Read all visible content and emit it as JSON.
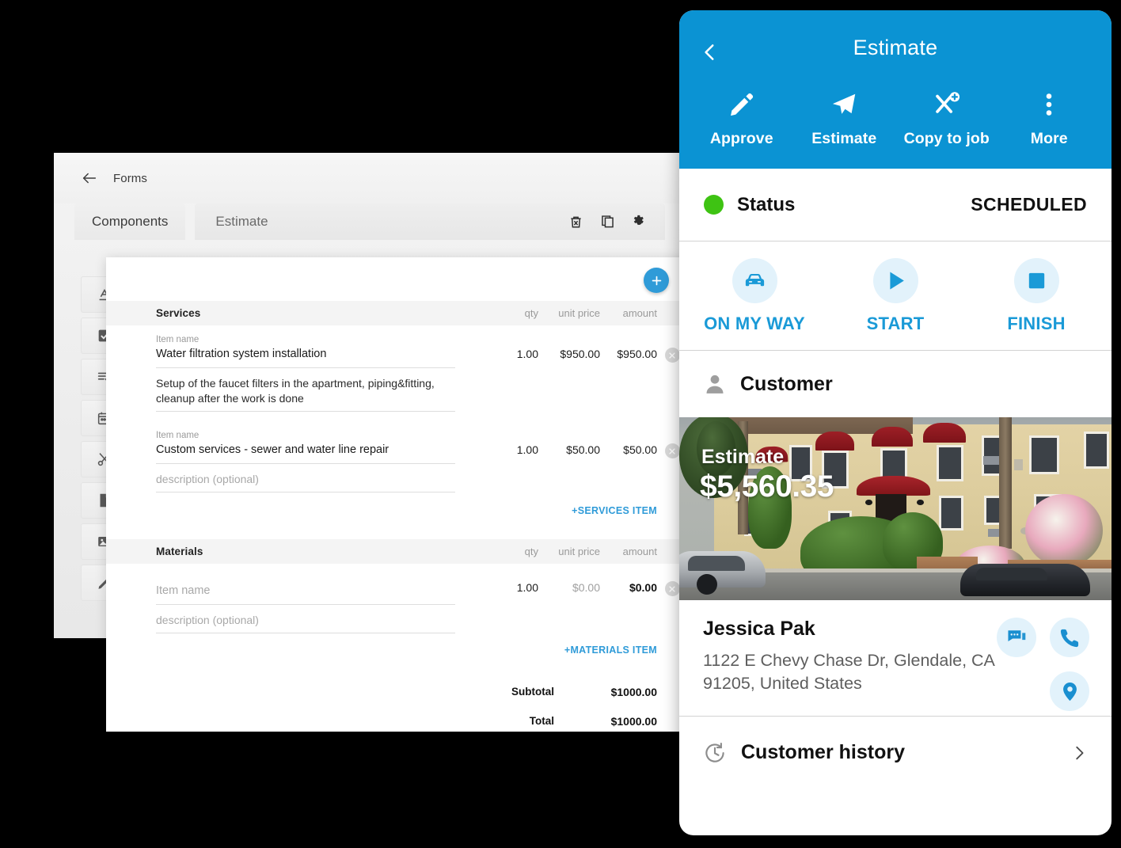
{
  "desktop": {
    "back_label": "Forms",
    "tabs": {
      "components": "Components",
      "estimate": "Estimate"
    },
    "tab_icons": [
      {
        "name": "delete-icon"
      },
      {
        "name": "duplicate-icon"
      },
      {
        "name": "settings-gear-icon"
      }
    ],
    "component_buttons": [
      {
        "name": "text-field-icon"
      },
      {
        "name": "checkbox-icon"
      },
      {
        "name": "checklist-icon"
      },
      {
        "name": "calendar-icon"
      },
      {
        "name": "scissors-icon"
      },
      {
        "name": "document-icon"
      },
      {
        "name": "image-icon"
      },
      {
        "name": "signature-pencil-icon"
      }
    ]
  },
  "form": {
    "add_button": "+",
    "services": {
      "title": "Services",
      "col_qty": "qty",
      "col_unit_price": "unit price",
      "col_amount": "amount",
      "items": [
        {
          "name_label": "Item name",
          "name_value": "Water filtration system installation",
          "description": "Setup of the  faucet filters in the apartment, piping&fitting, cleanup after the work is done",
          "qty": "1.00",
          "unit_price": "$950.00",
          "amount": "$950.00"
        },
        {
          "name_label": "Item name",
          "name_value": "Custom services - sewer and water line repair",
          "description": "description (optional)",
          "qty": "1.00",
          "unit_price": "$50.00",
          "amount": "$50.00"
        }
      ],
      "add_item_label": "+SERVICES ITEM"
    },
    "materials": {
      "title": "Materials",
      "col_qty": "qty",
      "col_unit_price": "unit price",
      "col_amount": "amount",
      "items": [
        {
          "name_value": "Item name",
          "description": "description (optional)",
          "qty": "1.00",
          "unit_price": "$0.00",
          "amount": "$0.00"
        }
      ],
      "add_item_label": "+MATERIALS ITEM"
    },
    "totals": {
      "subtotal_label": "Subtotal",
      "subtotal_value": "$1000.00",
      "total_label": "Total",
      "total_value": "$1000.00"
    }
  },
  "phone": {
    "accent_color": "#0b93d3",
    "title": "Estimate",
    "back_icon": "chevron-left-icon",
    "actions": [
      {
        "label": "Approve",
        "icon": "pencil-icon"
      },
      {
        "label": "Estimate",
        "icon": "send-paper-plane-icon"
      },
      {
        "label": "Copy to job",
        "icon": "tools-plus-icon"
      },
      {
        "label": "More",
        "icon": "overflow-menu-icon"
      }
    ],
    "status": {
      "label": "Status",
      "value": "SCHEDULED",
      "dot_color": "#3ec313"
    },
    "progress": [
      {
        "label": "ON MY WAY",
        "icon": "car-icon"
      },
      {
        "label": "START",
        "icon": "play-icon"
      },
      {
        "label": "FINISH",
        "icon": "stop-square-icon"
      }
    ],
    "customer_section": {
      "title": "Customer",
      "icon": "person-avatar-icon"
    },
    "photo": {
      "estimate_label": "Estimate",
      "estimate_amount": "$5,560.35"
    },
    "contact": {
      "name": "Jessica Pak",
      "address": "1122 E Chevy Chase Dr, Glendale, CA 91205, United States",
      "buttons": [
        {
          "name": "message-icon"
        },
        {
          "name": "phone-call-icon"
        },
        {
          "name": "map-pin-icon"
        }
      ]
    },
    "history": {
      "label": "Customer history",
      "icon": "history-clock-icon",
      "chevron": "chevron-right-icon"
    }
  }
}
